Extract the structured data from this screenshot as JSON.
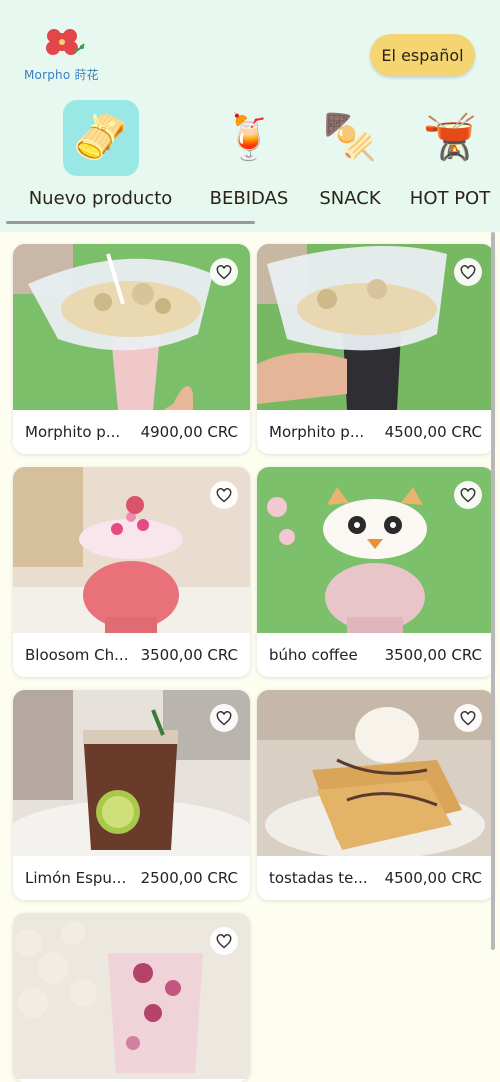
{
  "app": {
    "logo_text": "Morpho 莳花"
  },
  "header": {
    "language_button": "El español"
  },
  "categories": [
    {
      "label": "Nuevo producto",
      "icon": "tamale-icon",
      "glyph": "🫔",
      "active": true
    },
    {
      "label": "BEBIDAS",
      "icon": "tropical-drink-icon",
      "glyph": "🍹",
      "active": false
    },
    {
      "label": "SNACK",
      "icon": "oden-skewer-icon",
      "glyph": "🍢",
      "active": false
    },
    {
      "label": "HOT POT",
      "icon": "fondue-icon",
      "glyph": "🫕",
      "active": false
    }
  ],
  "products": [
    {
      "name": "Morphito p...",
      "price": "4900,00 CRC",
      "bg": "#7cbf6a"
    },
    {
      "name": "Morphito p...",
      "price": "4500,00 CRC",
      "bg": "#77b963"
    },
    {
      "name": "Bloosom Ch...",
      "price": "3500,00 CRC",
      "bg": "#e9ddcf"
    },
    {
      "name": "búho coffee",
      "price": "3500,00 CRC",
      "bg": "#7cc06b"
    },
    {
      "name": "Limón Espu...",
      "price": "2500,00 CRC",
      "bg": "#e6e1da"
    },
    {
      "name": "tostadas te...",
      "price": "4500,00 CRC",
      "bg": "#d9cfc3"
    },
    {
      "name": "",
      "price": "",
      "bg": "#ece7df"
    }
  ]
}
